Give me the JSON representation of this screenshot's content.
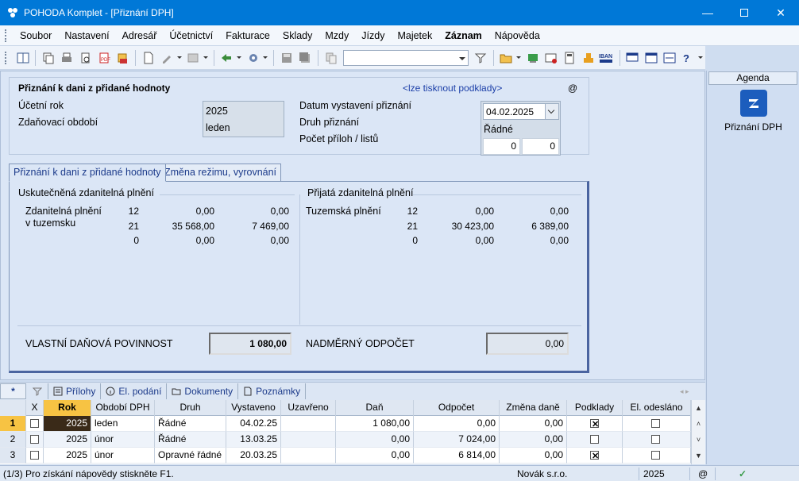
{
  "window": {
    "title": "POHODA Komplet - [Přiznání DPH]"
  },
  "menu": [
    "Soubor",
    "Nastavení",
    "Adresář",
    "Účetnictví",
    "Fakturace",
    "Sklady",
    "Mzdy",
    "Jízdy",
    "Majetek",
    "Záznam",
    "Nápověda"
  ],
  "header": {
    "title": "Přiznání k dani z přidané hodnoty",
    "print_link": "<lze tisknout podklady>",
    "at_symbol": "@",
    "ucetni_rok_label": "Účetní rok",
    "ucetni_rok_value": "2025",
    "obdobi_label": "Zdaňovací období",
    "obdobi_value": "leden",
    "datum_label": "Datum vystavení přiznání",
    "datum_value": "04.02.2025",
    "druh_label": "Druh přiznání",
    "druh_value": "Řádné",
    "pocet_label": "Počet příloh / listů",
    "pocet_prilohy": "0",
    "pocet_listy": "0"
  },
  "tabs": [
    "Přiznání k dani z přidané hodnoty",
    "Změna režimu, vyrovnání"
  ],
  "uskutecnena": {
    "title": "Uskutečněná zdanitelná plnění",
    "row_label_1": "Zdanitelná plnění",
    "row_label_2": "v tuzemsku",
    "rows": [
      {
        "rate": "12",
        "base": "0,00",
        "tax": "0,00"
      },
      {
        "rate": "21",
        "base": "35 568,00",
        "tax": "7 469,00"
      },
      {
        "rate": "0",
        "base": "0,00",
        "tax": "0,00"
      }
    ]
  },
  "prijata": {
    "title": "Přijatá zdanitelná plnění",
    "row_label": "Tuzemská plnění",
    "rows": [
      {
        "rate": "12",
        "base": "0,00",
        "tax": "0,00"
      },
      {
        "rate": "21",
        "base": "30 423,00",
        "tax": "6 389,00"
      },
      {
        "rate": "0",
        "base": "0,00",
        "tax": "0,00"
      }
    ]
  },
  "summary": {
    "povinnost_label": "VLASTNÍ DAŇOVÁ POVINNOST",
    "povinnost_value": "1 080,00",
    "odpocet_label": "NADMĚRNÝ ODPOČET",
    "odpocet_value": "0,00"
  },
  "agenda": {
    "title": "Agenda",
    "item_label": "Přiznání DPH"
  },
  "bottom_tabs": {
    "star": "*",
    "prilohy": "Přílohy",
    "el_podani": "El. podání",
    "dokumenty": "Dokumenty",
    "poznamky": "Poznámky"
  },
  "grid": {
    "columns": [
      "X",
      "Rok",
      "Období DPH",
      "Druh",
      "Vystaveno",
      "Uzavřeno",
      "Daň",
      "Odpočet",
      "Změna daně",
      "Podklady",
      "El. odesláno"
    ],
    "rows": [
      {
        "num": "1",
        "x": false,
        "rok": "2025",
        "obdobi": "leden",
        "druh": "Řádné",
        "vystaveno": "04.02.25",
        "uzavreno": "",
        "dan": "1 080,00",
        "odpocet": "0,00",
        "zmena": "0,00",
        "podklady": true,
        "odeslano": false
      },
      {
        "num": "2",
        "x": false,
        "rok": "2025",
        "obdobi": "únor",
        "druh": "Řádné",
        "vystaveno": "13.03.25",
        "uzavreno": "",
        "dan": "0,00",
        "odpocet": "7 024,00",
        "zmena": "0,00",
        "podklady": false,
        "odeslano": false
      },
      {
        "num": "3",
        "x": false,
        "rok": "2025",
        "obdobi": "únor",
        "druh": "Opravné řádné",
        "vystaveno": "20.03.25",
        "uzavreno": "",
        "dan": "0,00",
        "odpocet": "6 814,00",
        "zmena": "0,00",
        "podklady": true,
        "odeslano": false
      }
    ]
  },
  "status": {
    "help": "(1/3) Pro získání nápovědy stiskněte F1.",
    "company": "Novák s.r.o.",
    "year": "2025",
    "at": "@"
  },
  "colors": {
    "titlebar": "#0078d7",
    "accent": "#1c5dbd",
    "selected_row": "#f7c343"
  }
}
